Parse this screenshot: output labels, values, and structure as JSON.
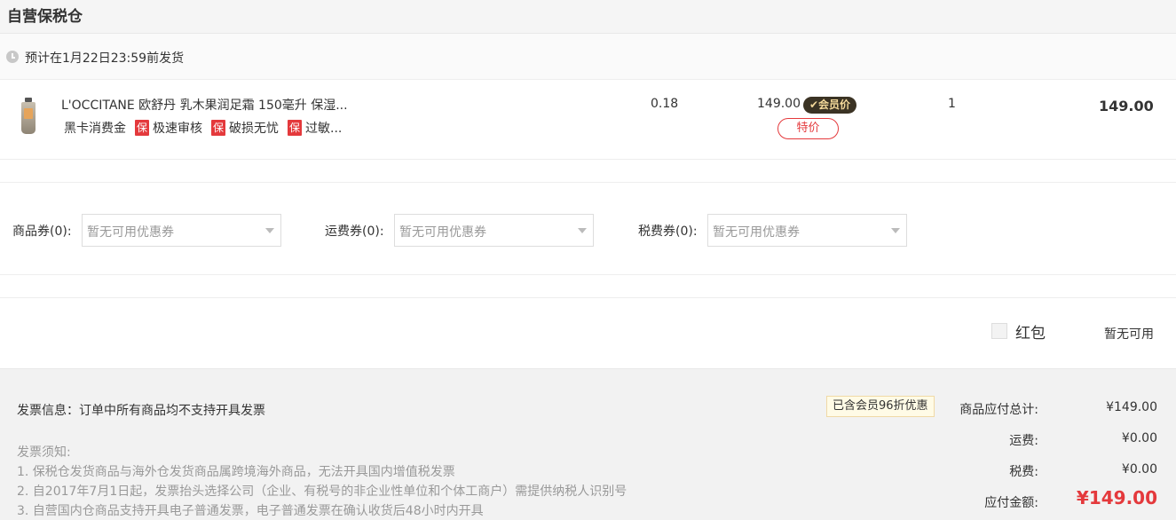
{
  "section": {
    "title": "自营保税仓"
  },
  "shipping": {
    "text": "预计在1月22日23:59前发货"
  },
  "product": {
    "name": "L'OCCITANE 欧舒丹 乳木果润足霜 150毫升 保湿...",
    "tag_plain": "黑卡消费金",
    "bao_label": "保",
    "tags": [
      "极速审核",
      "破损无忧",
      "过敏..."
    ],
    "tax_rate": "0.18",
    "unit_price": "149.00",
    "member_badge": "✔会员价",
    "special_tag": "特价",
    "quantity": "1",
    "subtotal": "149.00"
  },
  "coupons": [
    {
      "label": "商品券(0):",
      "placeholder": "暂无可用优惠券"
    },
    {
      "label": "运费券(0):",
      "placeholder": "暂无可用优惠券"
    },
    {
      "label": "税费券(0):",
      "placeholder": "暂无可用优惠券"
    }
  ],
  "red_packet": {
    "label": "红包",
    "status": "暂无可用"
  },
  "invoice": {
    "info": "发票信息：订单中所有商品均不支持开具发票",
    "notice_title": "发票须知:",
    "notices": [
      "1. 保税仓发货商品与海外仓发货商品属跨境海外商品，无法开具国内增值税发票",
      "2. 自2017年7月1日起，发票抬头选择公司（企业、有税号的非企业性单位和个体工商户）需提供纳税人识别号",
      "3. 自营国内仓商品支持开具电子普通发票，电子普通发票在确认收货后48小时内开具"
    ]
  },
  "summary": {
    "discount_badge": "已含会员96折优惠",
    "goods_total_label": "商品应付总计:",
    "goods_total": "¥149.00",
    "shipping_label": "运费:",
    "shipping": "¥0.00",
    "tax_label": "税费:",
    "tax": "¥0.00",
    "payable_label": "应付金额:",
    "payable": "¥149.00"
  },
  "colors": {
    "accent_red": "#e4393c",
    "member_badge_bg": "#3b3324",
    "member_badge_text": "#f3d89a"
  }
}
